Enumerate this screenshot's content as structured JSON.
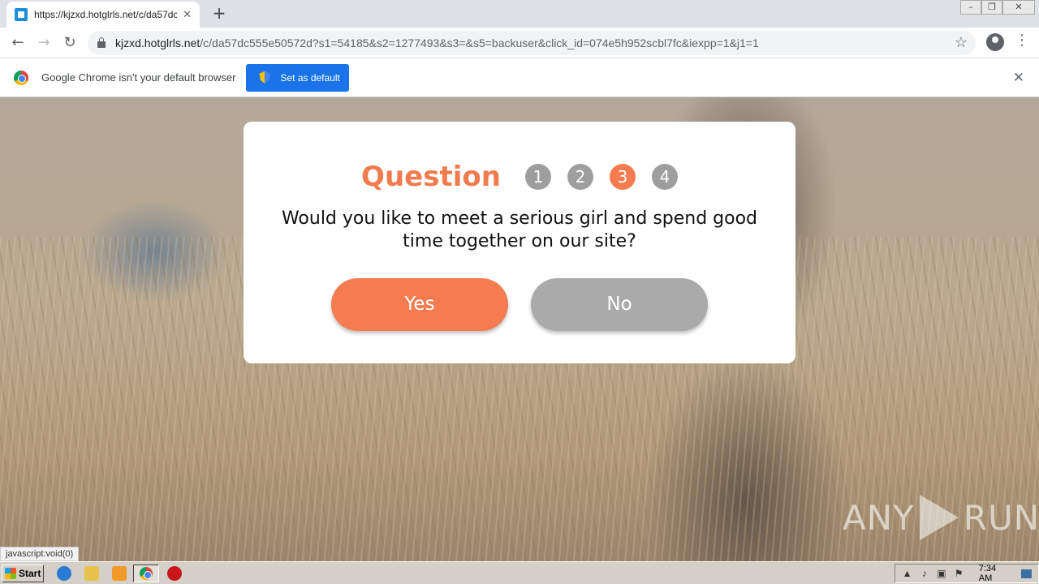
{
  "browser": {
    "tab_title": "https://kjzxd.hotglrls.net/c/da57dc5",
    "tab_close": "✕",
    "new_tab": "+",
    "url_host": "kjzxd.hotglrls.net",
    "url_path": "/c/da57dc555e50572d?s1=54185&s2=1277493&s3=&s5=backuser&click_id=074e5h952scbl7fc&iexpp=1&j1=1",
    "back": "←",
    "forward": "→",
    "reload": "↻",
    "star": "☆",
    "menu": "⋮",
    "window_controls": [
      "–",
      "❐",
      "✕"
    ]
  },
  "infobar": {
    "text": "Google Chrome isn't your default browser",
    "button": "Set as default",
    "close": "✕"
  },
  "modal": {
    "title": "Question",
    "steps": [
      "1",
      "2",
      "3",
      "4"
    ],
    "active_step": 3,
    "question": "Would you like to meet a serious girl and spend good time together on our site?",
    "yes": "Yes",
    "no": "No"
  },
  "watermark": {
    "left": "ANY",
    "right": "RUN"
  },
  "status_bar": "javascript:void(0)",
  "taskbar": {
    "start": "Start",
    "clock": "7:34 AM"
  },
  "colors": {
    "accent": "#f47c50",
    "inactive_step": "#9e9e9e",
    "chrome_blue": "#1a73e8"
  }
}
